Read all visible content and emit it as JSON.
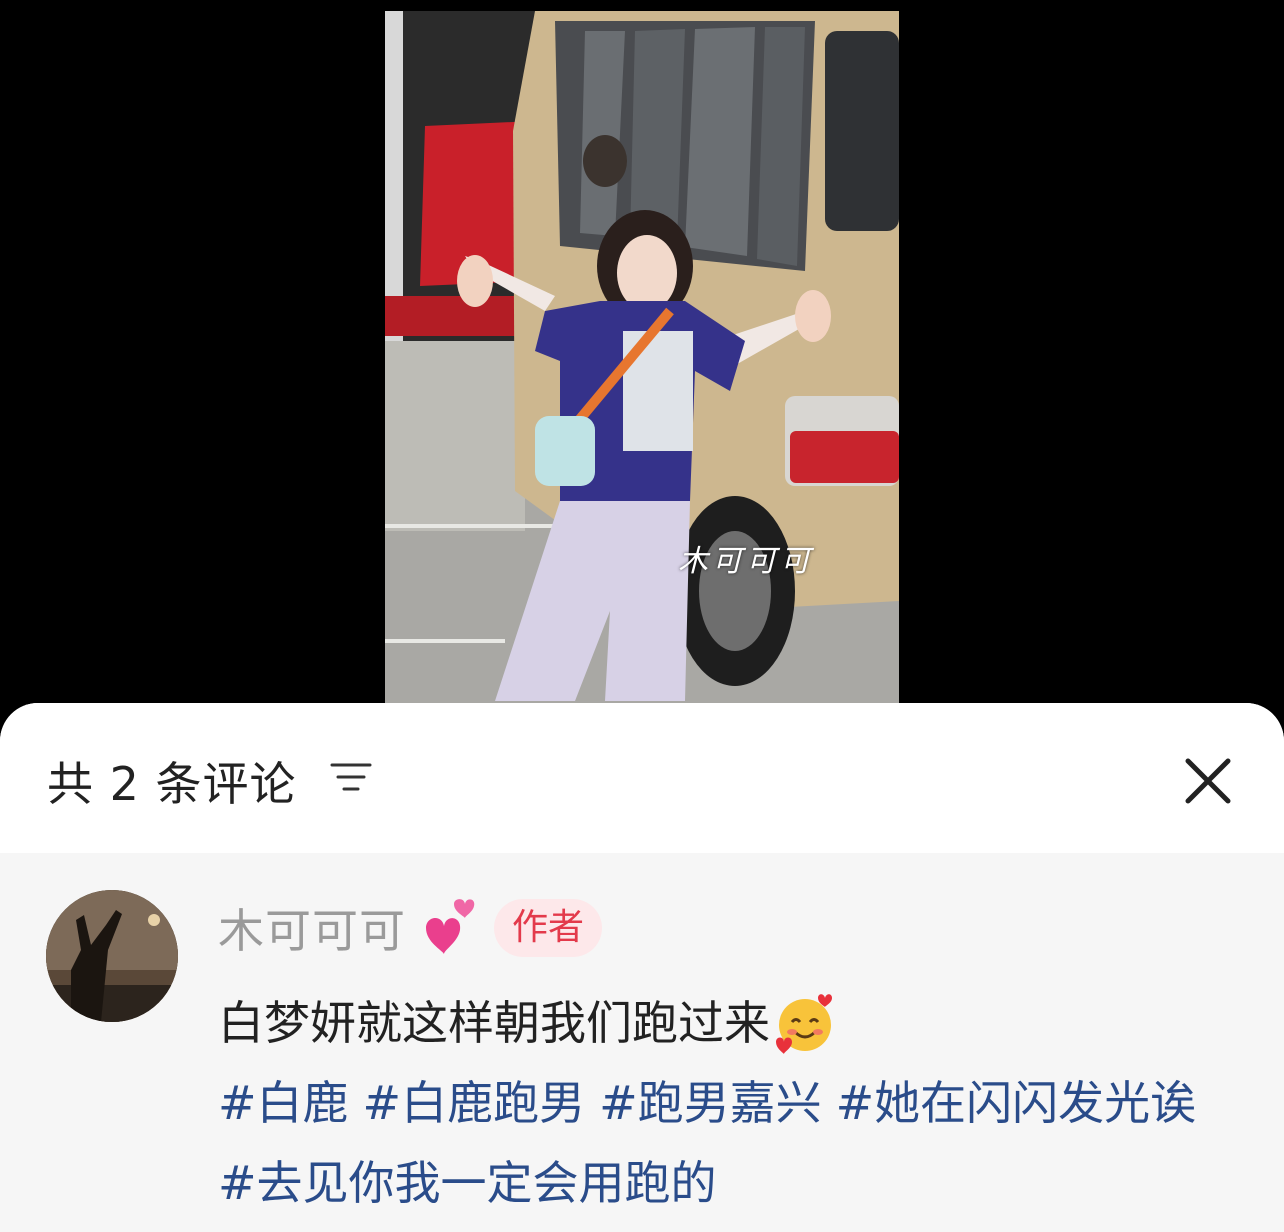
{
  "video": {
    "watermark": "木可可可"
  },
  "comments_sheet": {
    "count_title": "共 2 条评论",
    "sort_icon": "sort-lines-icon",
    "close_icon": "close-icon"
  },
  "comments": [
    {
      "author": "木可可可",
      "author_emoji": "two-hearts-emoji",
      "badge": "作者",
      "text": "白梦妍就这样朝我们跑过来",
      "text_emoji": "smiling-face-with-hearts-emoji",
      "hashtags": [
        "#白鹿",
        "#白鹿跑男",
        "#跑男嘉兴",
        "#她在闪闪发光诶",
        "#去见你我一定会用跑的"
      ]
    }
  ],
  "colors": {
    "hashtag": "#2a4c8a",
    "badge_text": "#e33a4b",
    "badge_bg": "#fde8ea",
    "author_name": "#9a9a9a"
  }
}
